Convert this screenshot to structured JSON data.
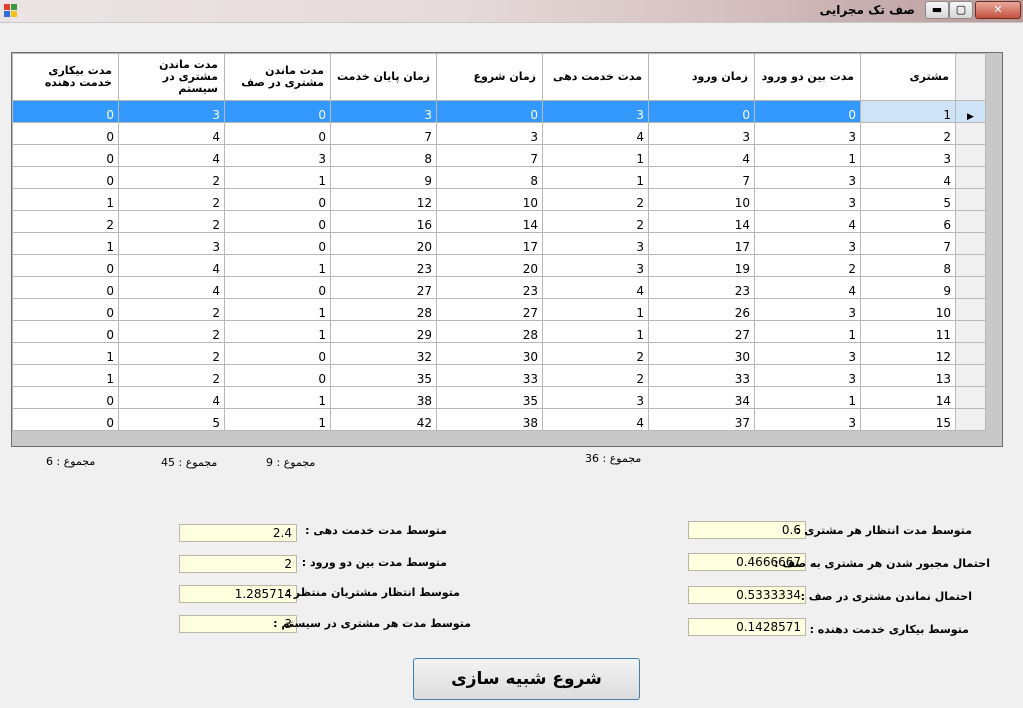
{
  "window": {
    "title": "صف تک مجرایی",
    "close_label": "✕",
    "max_label": "▢",
    "min_label": "▬"
  },
  "grid": {
    "columns": [
      "مشتری",
      "مدت بین دو ورود",
      "زمان ورود",
      "مدت خدمت دهی",
      "زمان شروع",
      "زمان پایان خدمت",
      "مدت ماندن مشتری در صف",
      "مدت ماندن مشتری در سیستم",
      "مدت بیکاری خدمت دهنده"
    ],
    "rows": [
      [
        "1",
        "0",
        "0",
        "3",
        "0",
        "3",
        "0",
        "3",
        "0"
      ],
      [
        "2",
        "3",
        "3",
        "4",
        "3",
        "7",
        "0",
        "4",
        "0"
      ],
      [
        "3",
        "1",
        "4",
        "1",
        "7",
        "8",
        "3",
        "4",
        "0"
      ],
      [
        "4",
        "3",
        "7",
        "1",
        "8",
        "9",
        "1",
        "2",
        "0"
      ],
      [
        "5",
        "3",
        "10",
        "2",
        "10",
        "12",
        "0",
        "2",
        "1"
      ],
      [
        "6",
        "4",
        "14",
        "2",
        "14",
        "16",
        "0",
        "2",
        "2"
      ],
      [
        "7",
        "3",
        "17",
        "3",
        "17",
        "20",
        "0",
        "3",
        "1"
      ],
      [
        "8",
        "2",
        "19",
        "3",
        "20",
        "23",
        "1",
        "4",
        "0"
      ],
      [
        "9",
        "4",
        "23",
        "4",
        "23",
        "27",
        "0",
        "4",
        "0"
      ],
      [
        "10",
        "3",
        "26",
        "1",
        "27",
        "28",
        "1",
        "2",
        "0"
      ],
      [
        "11",
        "1",
        "27",
        "1",
        "28",
        "29",
        "1",
        "2",
        "0"
      ],
      [
        "12",
        "3",
        "30",
        "2",
        "30",
        "32",
        "0",
        "2",
        "1"
      ],
      [
        "13",
        "3",
        "33",
        "2",
        "33",
        "35",
        "0",
        "2",
        "1"
      ],
      [
        "14",
        "1",
        "34",
        "3",
        "35",
        "38",
        "1",
        "4",
        "0"
      ],
      [
        "15",
        "3",
        "37",
        "4",
        "38",
        "42",
        "1",
        "5",
        "0"
      ]
    ],
    "current_row_marker": "▶"
  },
  "sums": {
    "service": "مجموع : 36",
    "queue": "مجموع : 9",
    "system": "مجموع : 45",
    "idle": "مجموع : 6"
  },
  "stats": {
    "avg_wait": {
      "label": "متوسط مدت انتظار هر مشتری :",
      "value": "0.6"
    },
    "prob_wait": {
      "label": "احتمال مجبور شدن هر مشتری به صف :",
      "value": "0.4666667"
    },
    "prob_no_wait": {
      "label": "احتمال نماندن مشتری در صف :",
      "value": "0.5333334"
    },
    "idle_server": {
      "label": "متوسط بیکاری خدمت دهنده :",
      "value": "0.1428571"
    },
    "avg_service": {
      "label": "متوسط مدت خدمت دهی :",
      "value": "2.4"
    },
    "avg_interarrival": {
      "label": "متوسط مدت بین دو ورود :",
      "value": "2"
    },
    "avg_waiting_customers": {
      "label": "متوسط  انتظار مشتریان  منتظر :",
      "value": "1.285714"
    },
    "avg_system": {
      "label": "متوسط مدت  هر مشتری در سیستم :",
      "value": "3"
    }
  },
  "start_button": {
    "label": "شروع  شبیه سازی"
  }
}
